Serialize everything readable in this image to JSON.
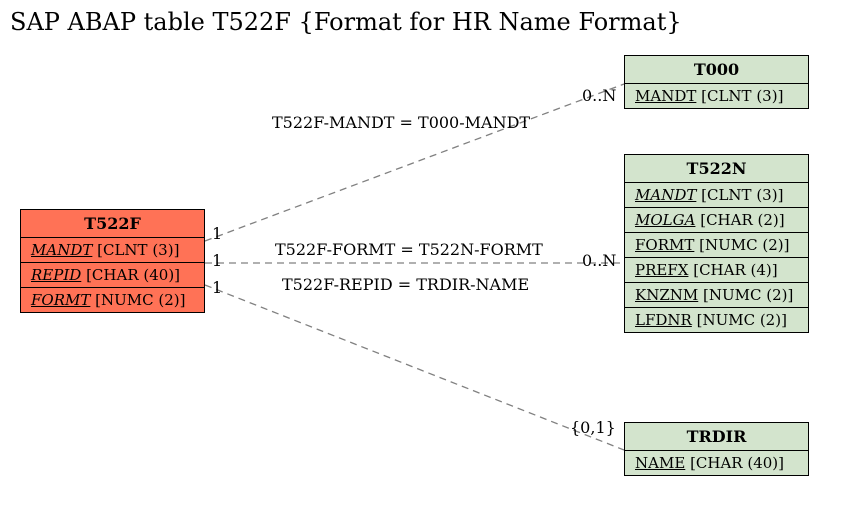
{
  "title": "SAP ABAP table T522F {Format for HR Name Format}",
  "tables": {
    "t522f": {
      "name": "T522F",
      "rows": [
        {
          "field": "MANDT",
          "type": "[CLNT (3)]",
          "kind": "fk"
        },
        {
          "field": "REPID",
          "type": "[CHAR (40)]",
          "kind": "fk"
        },
        {
          "field": "FORMT",
          "type": "[NUMC (2)]",
          "kind": "fk"
        }
      ]
    },
    "t000": {
      "name": "T000",
      "rows": [
        {
          "field": "MANDT",
          "type": "[CLNT (3)]",
          "kind": "pk"
        }
      ]
    },
    "t522n": {
      "name": "T522N",
      "rows": [
        {
          "field": "MANDT",
          "type": "[CLNT (3)]",
          "kind": "fk"
        },
        {
          "field": "MOLGA",
          "type": "[CHAR (2)]",
          "kind": "fk"
        },
        {
          "field": "FORMT",
          "type": "[NUMC (2)]",
          "kind": "pk"
        },
        {
          "field": "PREFX",
          "type": "[CHAR (4)]",
          "kind": "pk"
        },
        {
          "field": "KNZNM",
          "type": "[NUMC (2)]",
          "kind": "pk"
        },
        {
          "field": "LFDNR",
          "type": "[NUMC (2)]",
          "kind": "pk"
        }
      ]
    },
    "trdir": {
      "name": "TRDIR",
      "rows": [
        {
          "field": "NAME",
          "type": "[CHAR (40)]",
          "kind": "pk"
        }
      ]
    }
  },
  "edges": {
    "e1": {
      "label": "T522F-MANDT = T000-MANDT",
      "left_card": "1",
      "right_card": "0..N"
    },
    "e2": {
      "label": "T522F-FORMT = T522N-FORMT",
      "left_card": "1",
      "right_card": "0..N"
    },
    "e3": {
      "label": "T522F-REPID = TRDIR-NAME",
      "left_card": "1",
      "right_card": "{0,1}"
    }
  }
}
